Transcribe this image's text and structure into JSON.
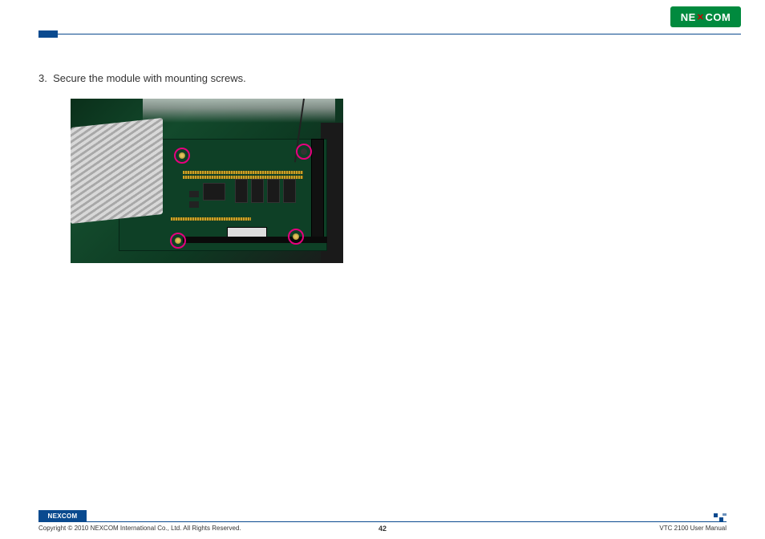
{
  "header": {
    "logo_text": "NEXCOM"
  },
  "content": {
    "step_number": "3.",
    "step_text": "Secure the module with mounting screws."
  },
  "footer": {
    "logo_text": "NEXCOM",
    "copyright": "Copyright © 2010 NEXCOM International Co., Ltd. All Rights Reserved.",
    "page_number": "42",
    "manual_name": "VTC 2100 User Manual"
  }
}
